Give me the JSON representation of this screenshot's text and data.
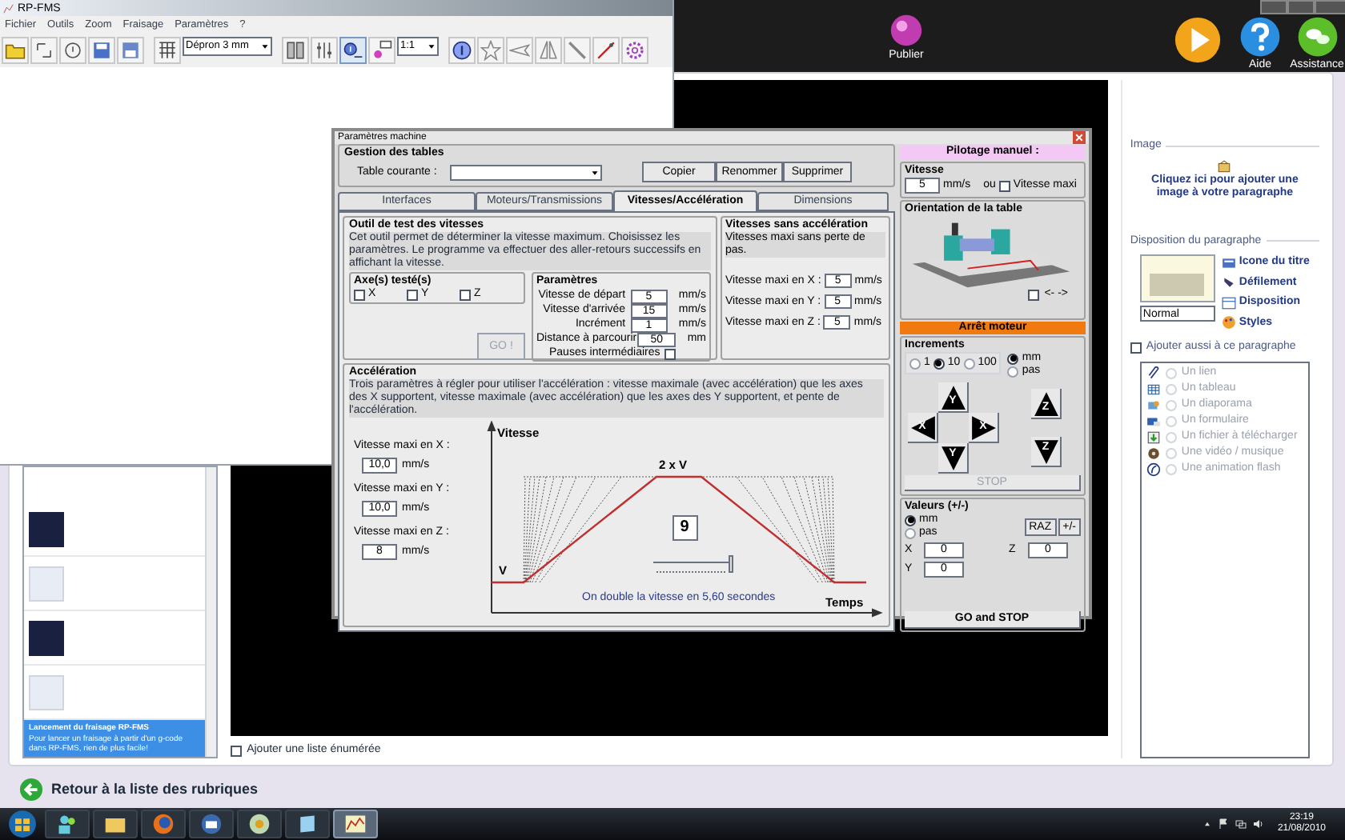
{
  "publisher": {
    "top_buttons": [
      {
        "label": "Publier"
      },
      {
        "label": "Aide"
      },
      {
        "label": "Assistance"
      }
    ],
    "topic_list": [
      {
        "title": "Lancement du fraisage RP-FMS",
        "text": "Pour lancer un fraisage à partir d'un g-code dans RP-FMS, rien de plus facile!",
        "selected": true
      }
    ],
    "add_list": {
      "label": "Ajouter une liste énumérée",
      "checked": false
    },
    "side_panel": {
      "image_title": "Image",
      "image_link": "Cliquez ici pour ajouter une image à votre paragraphe",
      "layout_title": "Disposition du paragraphe",
      "layout_links": [
        "Icone du titre",
        "Défilement",
        "Disposition",
        "Styles"
      ],
      "style_select": "Normal",
      "add_also": {
        "label": "Ajouter aussi à ce paragraphe",
        "checked": false
      },
      "add_items": [
        {
          "label": "Un lien",
          "selected": false
        },
        {
          "label": "Un tableau",
          "selected": false
        },
        {
          "label": "Un diaporama",
          "selected": false
        },
        {
          "label": "Un formulaire",
          "selected": false
        },
        {
          "label": "Un fichier à télécharger",
          "selected": false
        },
        {
          "label": "Une vidéo / musique",
          "selected": false
        },
        {
          "label": "Une animation flash",
          "selected": false
        }
      ]
    },
    "back_link": "Retour à la liste des rubriques"
  },
  "rpfms": {
    "title": "RP-FMS",
    "menu": [
      "Fichier",
      "Outils",
      "Zoom",
      "Fraisage",
      "Paramètres",
      "?"
    ],
    "material_select": "Dépron 3 mm",
    "scale_select": "1:1"
  },
  "dialog": {
    "title": "Paramètres machine",
    "tables": {
      "title": "Gestion des tables",
      "label": "Table courante :",
      "buttons": [
        "Copier",
        "Renommer",
        "Supprimer"
      ]
    },
    "tabs": [
      {
        "label": "Interfaces",
        "selected": false
      },
      {
        "label": "Moteurs/Transmissions",
        "selected": false
      },
      {
        "label": "Vitesses/Accélération",
        "selected": true
      },
      {
        "label": "Dimensions",
        "selected": false
      }
    ],
    "speed_test": {
      "title": "Outil de test des vitesses",
      "description": "Cet outil permet de déterminer la vitesse maximum. Choisissez les paramètres. Le programme va effectuer des aller-retours successifs en affichant la vitesse.",
      "axes_title": "Axe(s) testé(s)",
      "axes": [
        {
          "label": "X",
          "checked": false
        },
        {
          "label": "Y",
          "checked": false
        },
        {
          "label": "Z",
          "checked": false
        }
      ],
      "params_title": "Paramètres",
      "params": [
        {
          "label": "Vitesse de départ",
          "value": "5",
          "unit": "mm/s"
        },
        {
          "label": "Vitesse d'arrivée",
          "value": "15",
          "unit": "mm/s"
        },
        {
          "label": "Incrément",
          "value": "1",
          "unit": "mm/s"
        },
        {
          "label": "Distance à parcourir",
          "value": "50",
          "unit": "mm"
        }
      ],
      "pauses": {
        "label": "Pauses intermédiaires",
        "checked": false
      },
      "go_button": {
        "label": "GO !",
        "disabled": true
      }
    },
    "no_accel": {
      "title": "Vitesses sans accélération",
      "description": "Vitesses maxi sans perte de pas.",
      "fields": [
        {
          "label": "Vitesse maxi en X :",
          "value": "5",
          "unit": "mm/s"
        },
        {
          "label": "Vitesse maxi en Y :",
          "value": "5",
          "unit": "mm/s"
        },
        {
          "label": "Vitesse maxi en Z :",
          "value": "5",
          "unit": "mm/s"
        }
      ]
    },
    "acceleration": {
      "title": "Accélération",
      "description": "Trois paramètres à régler pour utiliser l'accélération : vitesse maximale (avec accélération) que les axes des X supportent, vitesse maximale (avec accélération) que les axes des Y supportent, et pente de l'accélération.",
      "fields": [
        {
          "label": "Vitesse maxi en X :",
          "value": "10,0",
          "unit": "mm/s"
        },
        {
          "label": "Vitesse maxi en Y :",
          "value": "10,0",
          "unit": "mm/s"
        },
        {
          "label": "Vitesse maxi en Z :",
          "value": "8",
          "unit": "mm/s"
        }
      ],
      "graph": {
        "y_axis": "Vitesse",
        "x_axis": "Temps",
        "top_label": "2 x V",
        "base_label": "V",
        "value": "9",
        "slider": {
          "level": 1
        },
        "caption": "On double la vitesse en 5,60 secondes"
      }
    },
    "manual": {
      "title": "Pilotage manuel :",
      "speed_title": "Vitesse",
      "speed_value": "5",
      "speed_unit": "mm/s",
      "or_label": "ou",
      "max_speed": {
        "label": "Vitesse maxi",
        "checked": false
      },
      "orientation_title": "Orientation de la table",
      "invert": {
        "label": "<- ->",
        "checked": false
      },
      "stop_banner": "Arrêt moteur",
      "increments_title": "Increments",
      "steps": [
        {
          "label": "1",
          "selected": false
        },
        {
          "label": "10",
          "selected": true
        },
        {
          "label": "100",
          "selected": false
        }
      ],
      "units": [
        {
          "label": "mm",
          "selected": true
        },
        {
          "label": "pas",
          "selected": false
        }
      ],
      "jog": {
        "y_up": "Y",
        "x_left": "X",
        "x_right": "X",
        "y_down": "Y",
        "z_up": "Z",
        "z_down": "Z"
      },
      "stop_button": {
        "label": "STOP",
        "disabled": true
      },
      "values_title": "Valeurs (+/-)",
      "value_units": [
        {
          "label": "mm",
          "selected": true
        },
        {
          "label": "pas",
          "selected": false
        }
      ],
      "reset_button": "RAZ",
      "sign_button": "+/-",
      "coords": [
        {
          "label": "X",
          "value": "0"
        },
        {
          "label": "Z",
          "value": "0"
        },
        {
          "label": "Y",
          "value": "0"
        }
      ],
      "go_stop_button": "GO and STOP"
    }
  },
  "taskbar": {
    "time": "23:19",
    "date": "21/08/2010"
  }
}
